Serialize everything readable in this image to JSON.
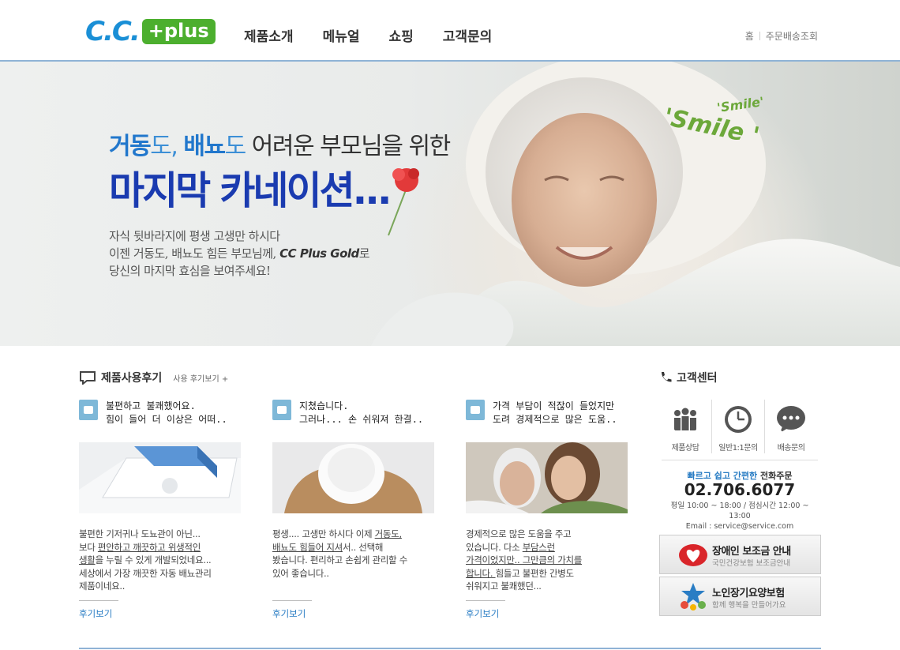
{
  "brand": {
    "logo_cc": "C.C.",
    "logo_plus": "+plus",
    "accent": "#3c8fd6",
    "green": "#4caf2e"
  },
  "gnb": [
    "제품소개",
    "메뉴얼",
    "쇼핑",
    "고객문의"
  ],
  "util": {
    "home": "홈",
    "order": "주문배송조회"
  },
  "visual": {
    "line1_a": "거동",
    "line1_b": "도, ",
    "line1_c": "배뇨",
    "line1_d": "도",
    "line1_e": " 어려운 부모님을 위한",
    "headline": "마지막 카네이션...",
    "body_1": "자식 뒷바라지에 평생 고생만 하시다",
    "body_2a": "이젠 거동도, 배뇨도 힘든 부모님께, ",
    "body_2b": "CC Plus Gold",
    "body_2c": "로",
    "body_3": "당신의 마지막 효심을 보여주세요!",
    "smile_big": "'Smile '",
    "smile_small": "'Smile'"
  },
  "reviews": {
    "title": "제품사용후기",
    "more": "사용 후기보기 +",
    "items": [
      {
        "q1": "불편하고 불쾌했어요.",
        "q2": "힘이 들어 더 이상은 어떠..",
        "t1": "불편한 기저귀나 도뇨관이 아닌...",
        "t2a": "보다 ",
        "t2b": "편안하고 깨끗하고 위생적인",
        "t3a": "생활",
        "t3b": "을 누릴 수 있게 개발되었네요...",
        "t4": "세상에서 가장 깨끗한 자동 배뇨관리",
        "t5": "제품이네요..",
        "link": "후기보기"
      },
      {
        "q1": "지쳤습니다.",
        "q2": "그러나... 손 쉬워져 한결..",
        "t1a": "평생.... 고생만 하시다 이제 ",
        "t1b": "거동도,",
        "t2a": "배뇨도 힘들어 지셔",
        "t2b": "서.. 선택해",
        "t3": "봤습니다. 편리하고 손쉽게 관리할 수",
        "t4": "있어 좋습니다..",
        "link": "후기보기"
      },
      {
        "q1": "가격 부담이 적잖이 들었지만",
        "q2": "도려 경제적으로 많은 도움..",
        "t1": "경제적으로 많은 도움을 주고",
        "t2a": "있습니다. 다소 ",
        "t2b": "부담스런",
        "t3": "가격이었지만.. 그만큼의 가치를",
        "t4a": "합니다. ",
        "t4b": "힘들고 불편한 간병도",
        "t5": "쉬워지고 불쾌했던...",
        "link": "후기보기"
      }
    ]
  },
  "cs": {
    "title": "고객센터",
    "icons": [
      "제품상담",
      "일반1:1문의",
      "배송문의"
    ],
    "lead_a": "빠르고 쉽고 간편한",
    "lead_b": " 전화주문",
    "phone": "02.706.6077",
    "hours": "평일 10:00 ~ 18:00 / 점심시간 12:00 ~ 13:00",
    "email": "Email : service@service.com",
    "banner1_title": "장애인 보조금 안내",
    "banner1_sub": "국민건강보험 보조금안내",
    "banner2_title": "노인장기요양보험",
    "banner2_sub": "함께 행복을 만들어가요"
  }
}
